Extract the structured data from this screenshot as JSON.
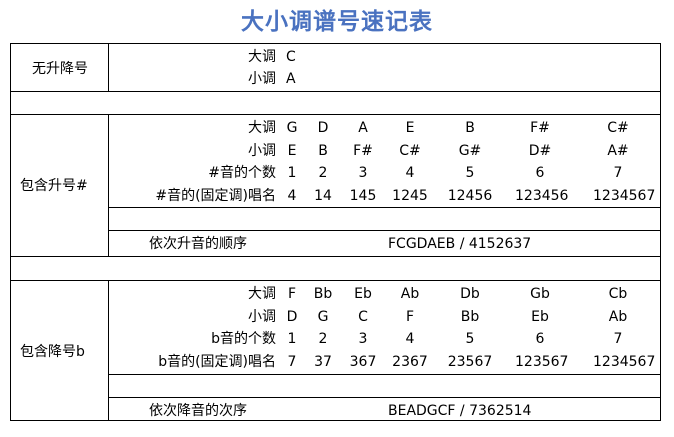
{
  "title": "大小调谱号速记表",
  "sections": {
    "none": {
      "label": "无升降号",
      "rows": [
        {
          "label": "大调",
          "values": [
            "C"
          ]
        },
        {
          "label": "小调",
          "values": [
            "A"
          ]
        }
      ]
    },
    "sharp": {
      "label": "包含升号#",
      "rows": [
        {
          "label": "大调",
          "values": [
            "G",
            "D",
            "A",
            "E",
            "B",
            "F#",
            "C#"
          ]
        },
        {
          "label": "小调",
          "values": [
            "E",
            "B",
            "F#",
            "C#",
            "G#",
            "D#",
            "A#"
          ]
        },
        {
          "label": "#音的个数",
          "values": [
            "1",
            "2",
            "3",
            "4",
            "5",
            "6",
            "7"
          ]
        },
        {
          "label": "#音的(固定调)唱名",
          "values": [
            "4",
            "14",
            "145",
            "1245",
            "12456",
            "123456",
            "1234567"
          ]
        }
      ],
      "order_label": "依次升音的顺序",
      "order_value": "FCGDAEB / 4152637"
    },
    "flat": {
      "label": "包含降号b",
      "rows": [
        {
          "label": "大调",
          "values": [
            "F",
            "Bb",
            "Eb",
            "Ab",
            "Db",
            "Gb",
            "Cb"
          ]
        },
        {
          "label": "小调",
          "values": [
            "D",
            "G",
            "C",
            "F",
            "Bb",
            "Eb",
            "Ab"
          ]
        },
        {
          "label": "b音的个数",
          "values": [
            "1",
            "2",
            "3",
            "4",
            "5",
            "6",
            "7"
          ]
        },
        {
          "label": "b音的(固定调)唱名",
          "values": [
            "7",
            "37",
            "367",
            "2367",
            "23567",
            "123567",
            "1234567"
          ]
        }
      ],
      "order_label": "依次降音的次序",
      "order_value": "BEADGCF / 7362514"
    }
  }
}
